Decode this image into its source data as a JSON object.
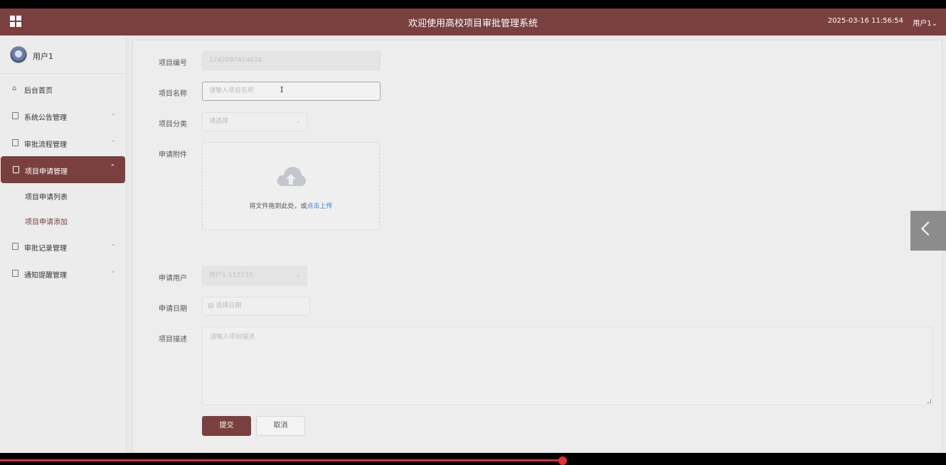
{
  "header": {
    "title": "欢迎使用高校项目审批管理系统",
    "datetime": "2025-03-16 11:56:54",
    "user_menu": "用户1⌄"
  },
  "sidebar": {
    "user_name": "用户1",
    "items": [
      {
        "label": "后台首页",
        "icon": "home-icon"
      },
      {
        "label": "系统公告管理",
        "icon": "doc-icon",
        "arrow": "⌄"
      },
      {
        "label": "审批流程管理",
        "icon": "doc-icon",
        "arrow": "⌄"
      },
      {
        "label": "项目申请管理",
        "icon": "doc-icon",
        "arrow": "⌃"
      },
      {
        "label": "审批记录管理",
        "icon": "doc-icon",
        "arrow": "⌄"
      },
      {
        "label": "通知提醒管理",
        "icon": "doc-icon",
        "arrow": "⌄"
      }
    ],
    "sub_items": [
      {
        "label": "项目申请列表"
      },
      {
        "label": "项目申请添加"
      }
    ]
  },
  "form": {
    "project_no": {
      "label": "项目编号",
      "value": "1742097414638"
    },
    "project_name": {
      "label": "项目名称",
      "placeholder": "请输入项目名称"
    },
    "category": {
      "label": "项目分类",
      "placeholder": "请选择"
    },
    "attachment": {
      "label": "申请附件",
      "drop_text": "将文件拖到此处，或",
      "upload_link": "点击上传"
    },
    "applicant": {
      "label": "申请用户",
      "value": "用户1-112233"
    },
    "date": {
      "label": "申请日期",
      "placeholder": "选择日期"
    },
    "description": {
      "label": "项目描述",
      "placeholder": "请输入项目描述"
    },
    "submit_label": "提交",
    "cancel_label": "取消"
  },
  "colors": {
    "brand": "#7a4040",
    "link": "#3a7fd0"
  }
}
